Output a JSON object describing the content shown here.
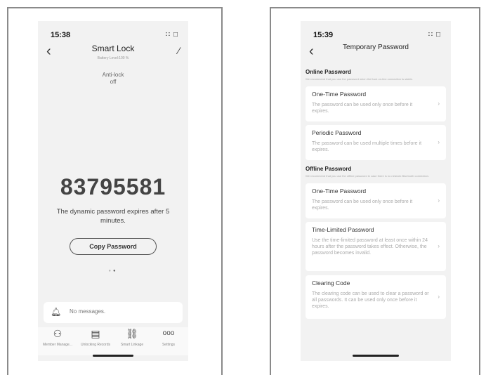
{
  "left_screen": {
    "status_bar": {
      "time": "15:38",
      "icons": "∷ □"
    },
    "nav": {
      "back": "‹",
      "title": "Smart Lock",
      "subtitle": "Battery Level:100 %",
      "edit": "∕"
    },
    "anti_lock": {
      "label": "Anti-lock",
      "value": "off"
    },
    "dynamic_password": "83795581",
    "expiry_text": "The dynamic password expires after 5 minutes.",
    "copy_button": "Copy Password",
    "page_dots": "●●",
    "messages": {
      "bell": "⍾",
      "text": "No messages."
    },
    "tabs": [
      {
        "icon": "⎕",
        "label": "Member Manage..."
      },
      {
        "icon": "☷",
        "label": "Unlocking Records"
      },
      {
        "icon": "❀",
        "label": "Smart Linkage"
      },
      {
        "icon": "◦◦◦",
        "label": "Settings"
      }
    ]
  },
  "right_screen": {
    "status_bar": {
      "time": "15:39",
      "icons": "∷ □"
    },
    "nav": {
      "back": "‹",
      "title": "Temporary Password"
    },
    "online": {
      "heading": "Online Password",
      "note": "We recommend that you use the password when the ilock on-line connection is stable.",
      "cards": [
        {
          "title": "One-Time Password",
          "desc": "The password can be used only once before it expires.",
          "chevron": "›"
        },
        {
          "title": "Periodic Password",
          "desc": "The password can be used multiple times before it expires.",
          "chevron": "›"
        }
      ]
    },
    "offline": {
      "heading": "Offline Password",
      "note": "We recommend that you use the offline password in case there is no network Bluetooth connection.",
      "cards": [
        {
          "title": "One-Time Password",
          "desc": "The password can be used only once before it expires.",
          "chevron": "›"
        },
        {
          "title": "Time-Limited Password",
          "desc": "Use the time-limited password at least once within 24 hours after the password takes effect. Otherwise, the password becomes invalid.",
          "chevron": "›"
        },
        {
          "title": "Clearing Code",
          "desc": "The clearing code can be used to clear a password or all passwords. It can be used only once before it expires.",
          "chevron": "›"
        }
      ]
    }
  }
}
